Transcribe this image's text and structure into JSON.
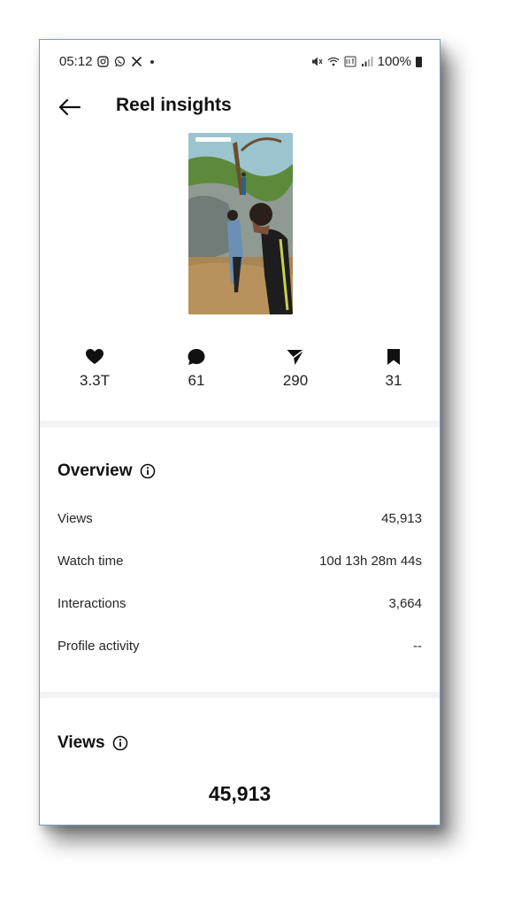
{
  "status_bar": {
    "time": "05:12",
    "left_icons": [
      "instagram-icon",
      "whatsapp-icon",
      "x-icon"
    ],
    "battery": "100%"
  },
  "header": {
    "title": "Reel insights"
  },
  "stats": [
    {
      "icon": "heart-icon",
      "value": "3.3T"
    },
    {
      "icon": "comment-icon",
      "value": "61"
    },
    {
      "icon": "share-icon",
      "value": "290"
    },
    {
      "icon": "bookmark-icon",
      "value": "31"
    }
  ],
  "overview": {
    "title": "Overview",
    "rows": [
      {
        "label": "Views",
        "value": "45,913"
      },
      {
        "label": "Watch time",
        "value": "10d 13h 28m 44s"
      },
      {
        "label": "Interactions",
        "value": "3,664"
      },
      {
        "label": "Profile activity",
        "value": "--"
      }
    ]
  },
  "views": {
    "title": "Views",
    "total": "45,913"
  }
}
